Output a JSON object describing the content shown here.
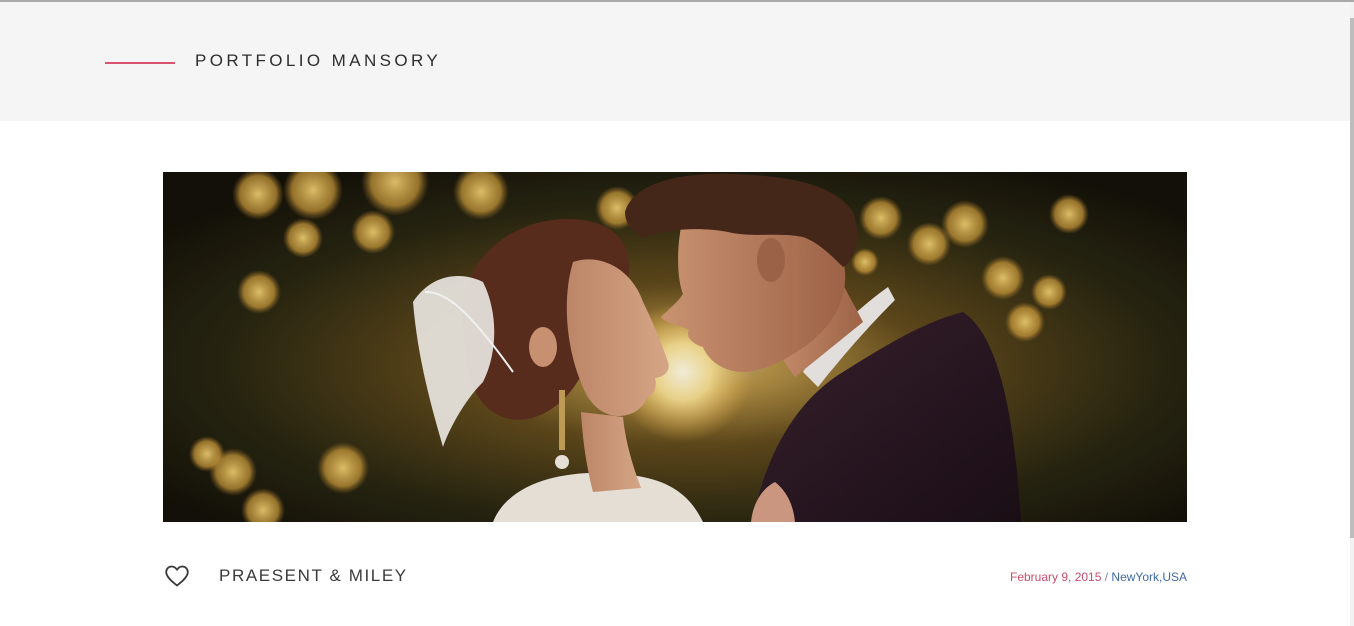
{
  "header": {
    "title": "PORTFOLIO MANSORY"
  },
  "portfolio_item": {
    "title": "PRAESENT & MILEY",
    "date": "February 9, 2015",
    "separator": "/",
    "location": "NewYork,USA",
    "like_icon": "heart-outline-icon"
  },
  "colors": {
    "accent": "#d9536f",
    "date": "#c94b6c",
    "link": "#3f6aa3",
    "header_bg": "#f5f5f5"
  }
}
